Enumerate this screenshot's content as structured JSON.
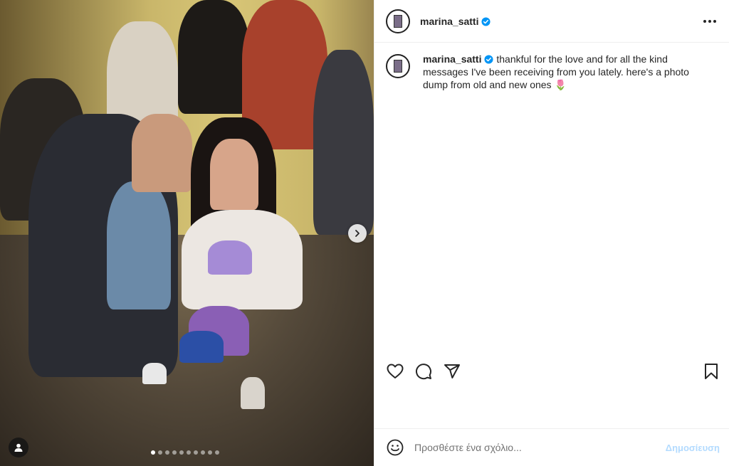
{
  "post": {
    "username": "marina_satti",
    "verified": true,
    "caption": "thankful for the love and for all the kind messages I've been receiving from you lately. here's a photo dump from old and new ones 🌷",
    "carousel_total": 10,
    "carousel_current_index": 0
  },
  "icons": {
    "like": "heart-icon",
    "comment": "comment-icon",
    "share": "paper-plane-icon",
    "save": "bookmark-icon",
    "more": "more-options-icon",
    "next": "chevron-right-icon",
    "user_tags": "user-icon",
    "emoji": "emoji-icon",
    "verified": "verified-badge-icon"
  },
  "comment": {
    "placeholder": "Προσθέστε ένα σχόλιο...",
    "post_label": "Δημοσίευση"
  },
  "colors": {
    "verified_blue": "#0095f6",
    "post_button_disabled": "#b3dbff",
    "text": "#262626"
  }
}
